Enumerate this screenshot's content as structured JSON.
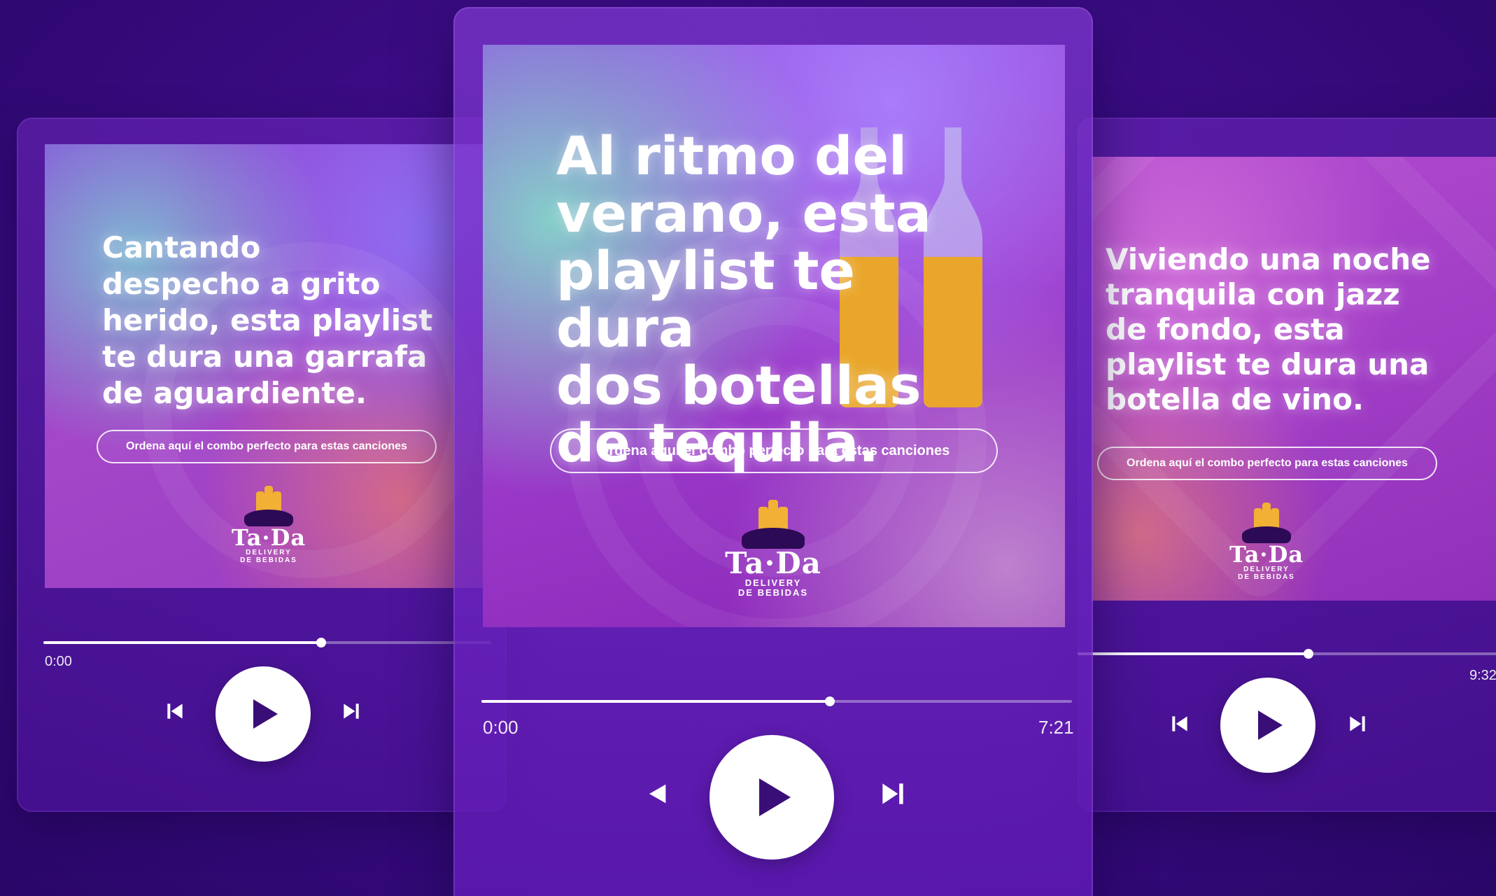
{
  "colors": {
    "background": "#3c0c86",
    "accent_gold": "#f2b035",
    "play_icon": "#3a0e77",
    "text": "#ffffff"
  },
  "cards": {
    "left": {
      "headline": "Cantando\ndespecho a grito\nherido, esta playlist\nte dura una garrafa\nde aguardiente.",
      "cta": "Ordena aquí el combo perfecto para estas canciones",
      "logo_word": "Ta·Da",
      "logo_sub": "DELIVERY\nDE BEBIDAS",
      "time_start": "0:00",
      "progress": 0.62,
      "icons": {
        "prev": "skip-previous-icon",
        "play": "play-icon",
        "next": "skip-next-icon"
      }
    },
    "center": {
      "headline": "Al ritmo del\nverano, esta\nplaylist te dura\ndos botellas\nde tequila.",
      "cta": "Ordena aquí el combo perfecto para estas canciones",
      "logo_word": "Ta·Da",
      "logo_sub": "DELIVERY\nDE BEBIDAS",
      "time_start": "0:00",
      "time_end": "7:21",
      "progress": 0.59,
      "icons": {
        "prev": "previous-icon",
        "play": "play-icon",
        "next": "skip-next-icon"
      }
    },
    "right": {
      "headline": "Viviendo una noche\ntranquila con jazz\nde fondo, esta\nplaylist te dura una\nbotella de vino.",
      "cta": "Ordena aquí el combo perfecto para estas canciones",
      "logo_word": "Ta·Da",
      "logo_sub": "DELIVERY\nDE BEBIDAS",
      "time_end": "9:32",
      "progress": 0.55,
      "icons": {
        "prev": "skip-previous-icon",
        "play": "play-icon",
        "next": "skip-next-icon"
      }
    }
  }
}
